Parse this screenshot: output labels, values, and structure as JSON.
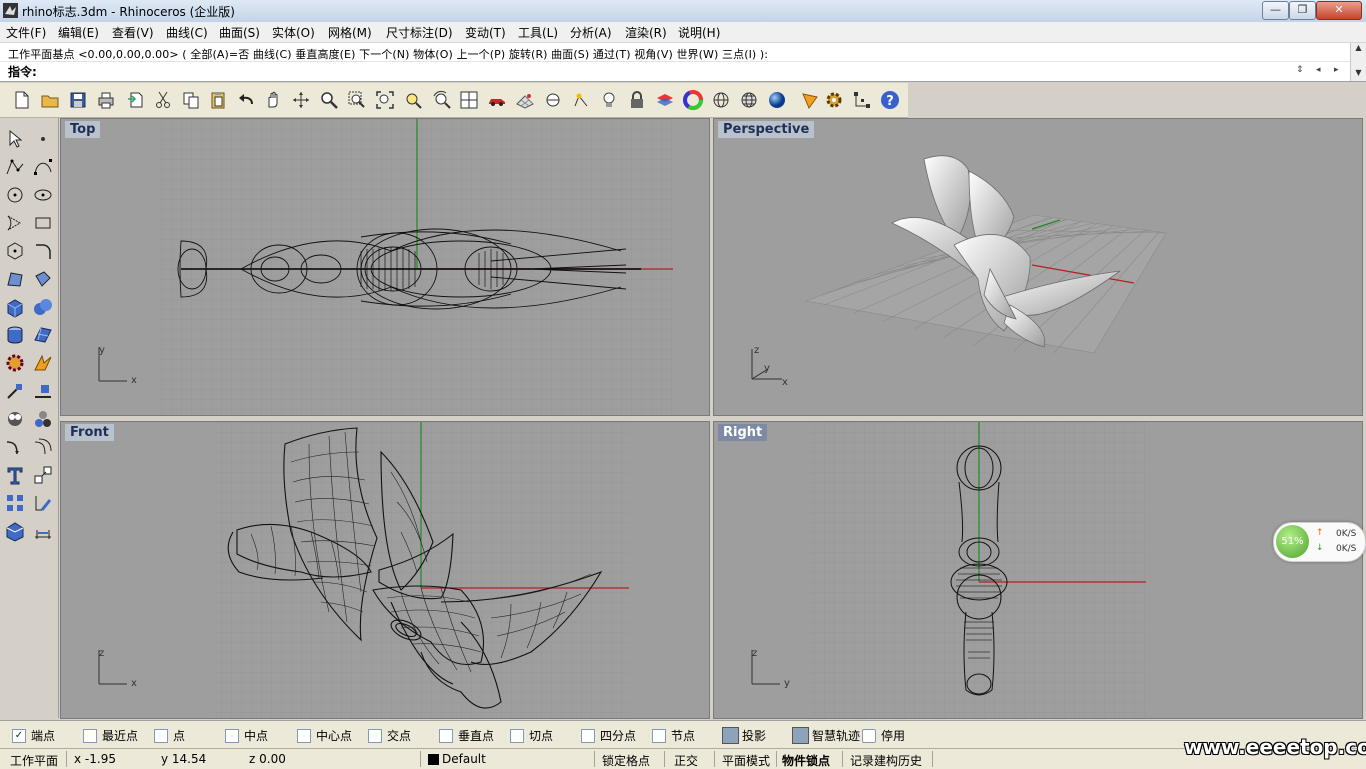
{
  "window": {
    "title": "rhino标志.3dm - Rhinoceros (企业版)",
    "buttons": {
      "minimize": "—",
      "maximize": "❐",
      "close": "✕"
    }
  },
  "menu": [
    "文件(F)",
    "编辑(E)",
    "查看(V)",
    "曲线(C)",
    "曲面(S)",
    "实体(O)",
    "网格(M)",
    "尺寸标注(D)",
    "变动(T)",
    "工具(L)",
    "分析(A)",
    "渲染(R)",
    "说明(H)"
  ],
  "command": {
    "history": "工作平面基点 <0.00,0.00,0.00> ( 全部(A)=否  曲线(C)  垂直高度(E)  下一个(N)  物体(O)  上一个(P)  旋转(R)  曲面(S)  通过(T)  视角(V)  世界(W)  三点(I) ):",
    "prompt": "指令:"
  },
  "toolbar_icons": [
    "new-file-icon",
    "open-file-icon",
    "save-icon",
    "print-icon",
    "import-icon",
    "cut-icon",
    "copy-icon",
    "paste-icon",
    "undo-icon",
    "pan-icon",
    "rotate-view-icon",
    "zoom-icon",
    "zoom-window-icon",
    "zoom-extents-icon",
    "zoom-selected-icon",
    "zoom-restore-icon",
    "four-viewports-icon",
    "car-icon",
    "grid-plane-icon",
    "cplane-icon",
    "point-icon",
    "light-icon",
    "lock-icon",
    "layer-icon",
    "color-wheel-icon",
    "wireframe-sphere-icon",
    "ghosted-sphere-icon",
    "rendered-sphere-icon",
    "render-cone-icon",
    "options-gear-icon",
    "snap-points-icon",
    "help-icon"
  ],
  "viewports": {
    "top": {
      "label": "Top",
      "axes": {
        "a": "y",
        "b": "x"
      }
    },
    "perspective": {
      "label": "Perspective",
      "axes": {
        "a": "z",
        "b": "y",
        "c": "x"
      }
    },
    "front": {
      "label": "Front",
      "axes": {
        "a": "z",
        "b": "x"
      }
    },
    "right": {
      "label": "Right",
      "axes": {
        "a": "z",
        "b": "y"
      }
    }
  },
  "osnap": [
    {
      "label": "端点",
      "checked": true
    },
    {
      "label": "最近点",
      "checked": false
    },
    {
      "label": "点",
      "checked": false
    },
    {
      "label": "中点",
      "checked": false
    },
    {
      "label": "中心点",
      "checked": false
    },
    {
      "label": "交点",
      "checked": false
    },
    {
      "label": "垂直点",
      "checked": false
    },
    {
      "label": "切点",
      "checked": false
    },
    {
      "label": "四分点",
      "checked": false
    },
    {
      "label": "节点",
      "checked": false
    }
  ],
  "osnap_buttons": {
    "project": "投影",
    "smarttrack": "智慧轨迹",
    "disable": "停用"
  },
  "status": {
    "cplane": "工作平面",
    "x": "x -1.95",
    "y": "y 14.54",
    "z": "z 0.00",
    "layer": "Default",
    "grid_snap": "锁定格点",
    "ortho": "正交",
    "planar": "平面模式",
    "osnap": "物件锁点",
    "history": "记录建构历史"
  },
  "network": {
    "percent": "51%",
    "up": "0K/S",
    "down": "0K/S"
  },
  "watermark": "www.eeeetop.com",
  "colors": {
    "viewport_bg": "#9e9e9e",
    "grid_minor": "#8f8f8f",
    "grid_major": "#7c7c7c",
    "x_axis": "#b22222",
    "y_axis": "#1f8a1f"
  }
}
